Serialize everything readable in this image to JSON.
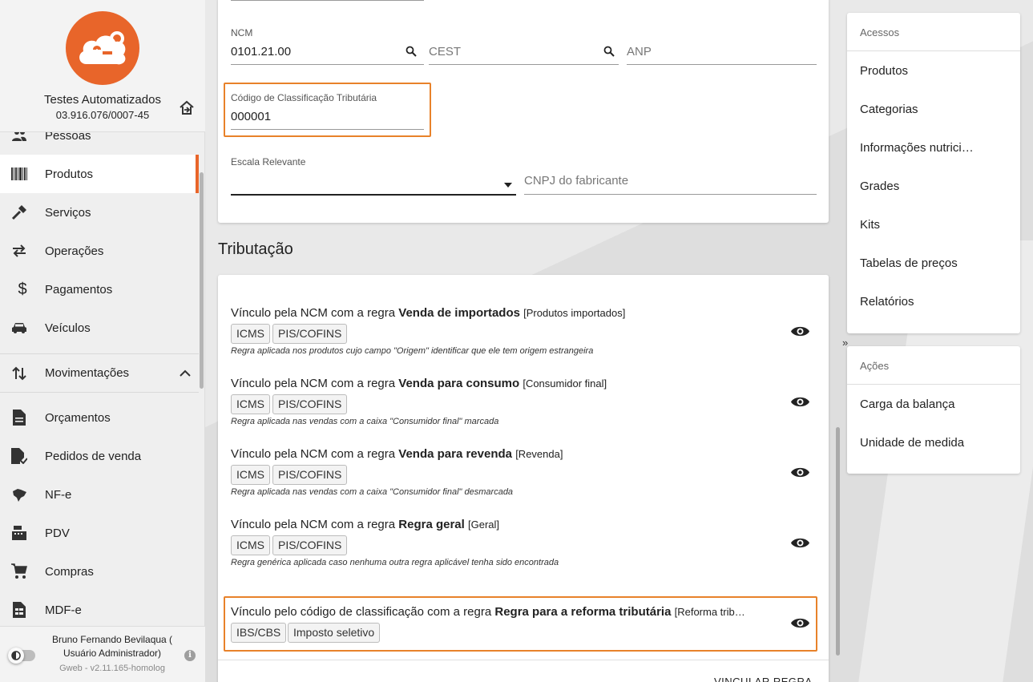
{
  "sidebar": {
    "company_name": "Testes Automatizados",
    "company_doc": "03.916.076/0007-45",
    "items": [
      {
        "label": "Pessoas",
        "icon": "people-icon"
      },
      {
        "label": "Produtos",
        "icon": "barcode-icon",
        "active": true
      },
      {
        "label": "Serviços",
        "icon": "hammer-icon"
      },
      {
        "label": "Operações",
        "icon": "swap-icon"
      },
      {
        "label": "Pagamentos",
        "icon": "dollar-icon"
      },
      {
        "label": "Veículos",
        "icon": "car-icon"
      },
      {
        "label": "Movimentações",
        "icon": "sort-arrows-icon",
        "group": true
      },
      {
        "label": "Orçamentos",
        "icon": "document-icon"
      },
      {
        "label": "Pedidos de venda",
        "icon": "document-check-icon"
      },
      {
        "label": "NF-e",
        "icon": "brazil-map-icon"
      },
      {
        "label": "PDV",
        "icon": "cash-register-icon"
      },
      {
        "label": "Compras",
        "icon": "cart-icon"
      },
      {
        "label": "MDF-e",
        "icon": "document-list-icon"
      }
    ],
    "user": "Bruno Fernando Bevilaqua ( Usuário Administrador)",
    "version": "Gweb - v2.11.165-homolog"
  },
  "form": {
    "ncm_label": "NCM",
    "ncm_value": "0101.21.00",
    "cest_placeholder": "CEST",
    "anp_placeholder": "ANP",
    "cct_label": "Código de Classificação Tributária",
    "cct_value": "000001",
    "escala_label": "Escala Relevante",
    "cnpj_placeholder": "CNPJ do fabricante"
  },
  "tributacao": {
    "title": "Tributação",
    "rules": [
      {
        "prefix": "Vínculo pela NCM com a regra ",
        "name": "Venda de importados",
        "tag": "[Produtos importados]",
        "chips": [
          "ICMS",
          "PIS/COFINS"
        ],
        "desc": "Regra aplicada nos produtos cujo campo \"Origem\" identificar que ele tem origem estrangeira"
      },
      {
        "prefix": "Vínculo pela NCM com a regra ",
        "name": "Venda para consumo",
        "tag": "[Consumidor final]",
        "chips": [
          "ICMS",
          "PIS/COFINS"
        ],
        "desc": "Regra aplicada nas vendas com a caixa \"Consumidor final\" marcada"
      },
      {
        "prefix": "Vínculo pela NCM com a regra ",
        "name": "Venda para revenda",
        "tag": "[Revenda]",
        "chips": [
          "ICMS",
          "PIS/COFINS"
        ],
        "desc": "Regra aplicada nas vendas com a caixa \"Consumidor final\" desmarcada"
      },
      {
        "prefix": "Vínculo pela NCM com a regra ",
        "name": "Regra geral",
        "tag": "[Geral]",
        "chips": [
          "ICMS",
          "PIS/COFINS"
        ],
        "desc": "Regra genérica aplicada caso nenhuma outra regra aplicável tenha sido encontrada"
      },
      {
        "prefix": "Vínculo pelo código de classificação com a regra ",
        "name": "Regra para a reforma tributária",
        "tag": "[Reforma trib…",
        "chips": [
          "IBS/CBS",
          "Imposto seletivo"
        ],
        "desc": ""
      }
    ],
    "vincular_label": "VINCULAR REGRA"
  },
  "acessos": {
    "heading": "Acessos",
    "links": [
      "Produtos",
      "Categorias",
      "Informações nutrici…",
      "Grades",
      "Kits",
      "Tabelas de preços",
      "Relatórios"
    ]
  },
  "acoes": {
    "heading": "Ações",
    "links": [
      "Carga da balança",
      "Unidade de medida"
    ]
  },
  "colors": {
    "accent": "#e8652a",
    "highlight": "#e8822a"
  }
}
